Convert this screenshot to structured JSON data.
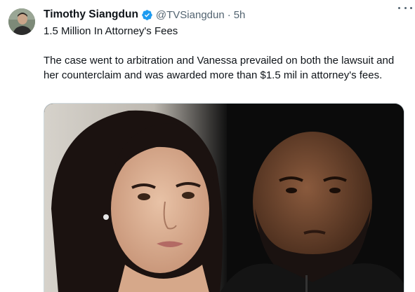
{
  "author": {
    "display_name": "Timothy Siangdun",
    "handle": "@TVSiangdun",
    "separator": "·",
    "time": "5h",
    "verified_icon": "verified-badge-icon"
  },
  "menu": {
    "icon": "more-options-icon"
  },
  "tweet": {
    "headline": "1.5 Million In Attorney's Fees",
    "body": "The case went to arbitration and Vanessa prevailed on both the lawsuit and her counterclaim and was awarded more than $1.5 mil in attorney's fees."
  },
  "media": {
    "type": "photo",
    "colors": {
      "left_background": "#d9d5cf",
      "right_background": "#0b0b0b"
    }
  },
  "colors": {
    "verified": "#1d9bf0",
    "secondary_text": "#536471",
    "primary_text": "#0f1419"
  }
}
